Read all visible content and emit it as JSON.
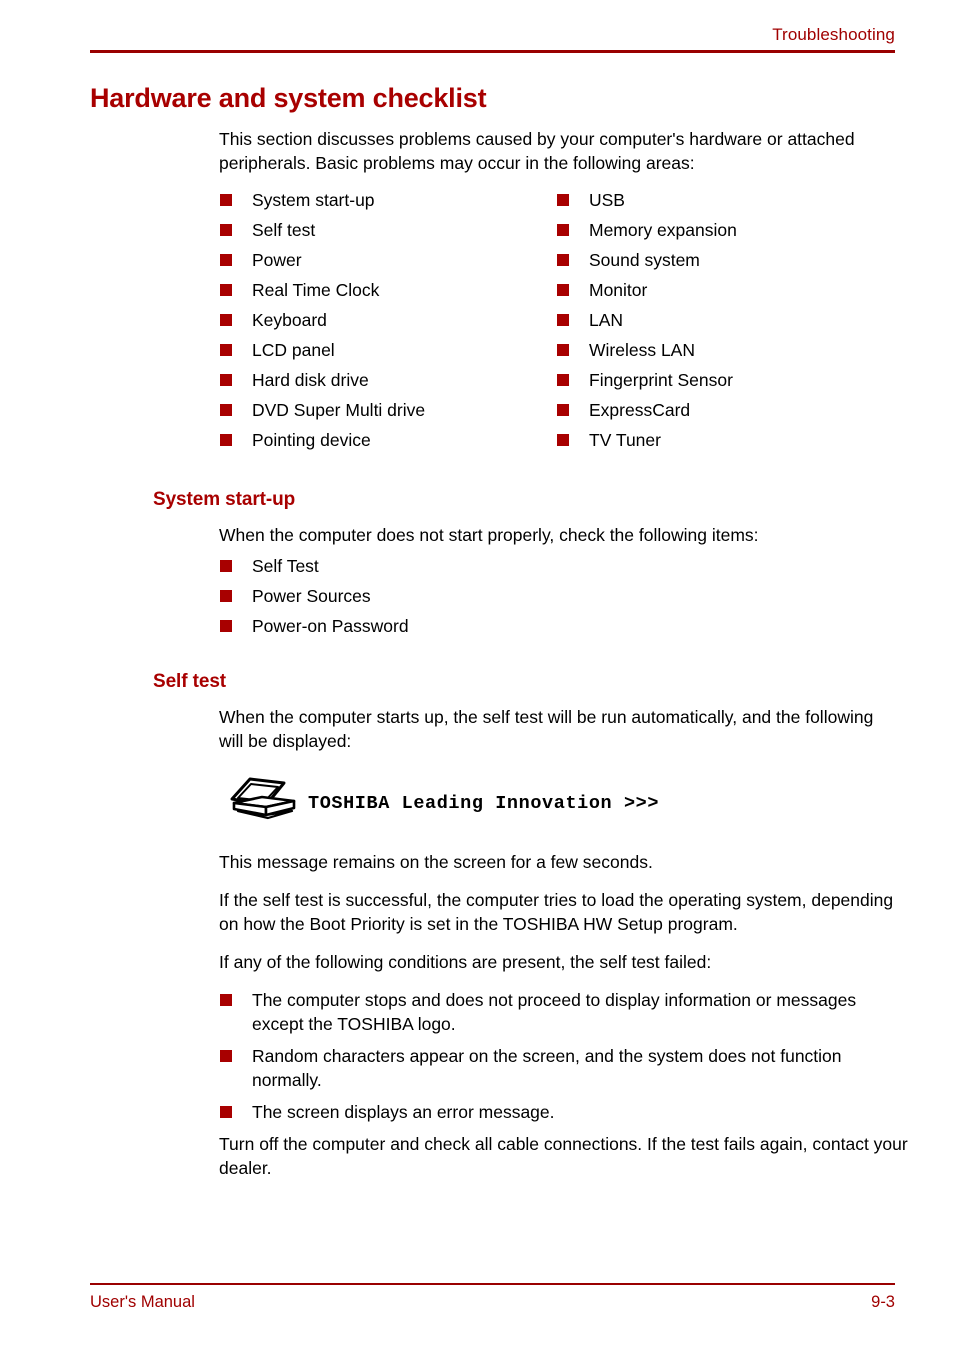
{
  "header": {
    "title": "Troubleshooting"
  },
  "heading": {
    "main": "Hardware and system checklist"
  },
  "intro": {
    "paragraph": "This section discusses problems caused by your computer's hardware or attached peripherals. Basic problems may occur in the following areas:"
  },
  "checklist": {
    "left": [
      "System start-up",
      "Self test",
      "Power",
      "Real Time Clock",
      "Keyboard",
      "LCD panel",
      "Hard disk drive",
      "DVD Super Multi drive",
      "Pointing device"
    ],
    "right": [
      "USB",
      "Memory expansion",
      "Sound system",
      "Monitor",
      "LAN",
      "Wireless LAN",
      "Fingerprint Sensor",
      "ExpressCard",
      "TV Tuner"
    ]
  },
  "system_startup": {
    "heading": "System start-up",
    "paragraph": "When the computer does not start properly, check the following items:",
    "items": [
      "Self Test",
      "Power Sources",
      "Power-on Password"
    ]
  },
  "self_test": {
    "heading": "Self test",
    "paragraph": "When the computer starts up, the self test will be run automatically, and the following will be displayed:",
    "banner_text": "TOSHIBA Leading Innovation >>>",
    "laptop_icon_name": "laptop-icon",
    "paragraph_2": "This message remains on the screen for a few seconds.",
    "paragraph_3": "If the self test is successful, the computer tries to load the operating system, depending on how the Boot Priority is set in the TOSHIBA HW Setup program.",
    "paragraph_4": "If any of the following conditions are present, the self test failed:",
    "failure_items": [
      "The computer stops and does not proceed to display information or messages except the TOSHIBA logo.",
      "Random characters appear on the screen, and the system does not function normally.",
      "The screen displays an error message."
    ],
    "paragraph_5": "Turn off the computer and check all cable connections. If the test fails again, contact your dealer."
  },
  "footer": {
    "left": "User's Manual",
    "right": "9-3"
  },
  "colors": {
    "accent_red": "#A80000",
    "rule_red": "#990000",
    "header_red": "#A00000",
    "text_black": "#000000",
    "page_background": "#FFFFFF"
  }
}
